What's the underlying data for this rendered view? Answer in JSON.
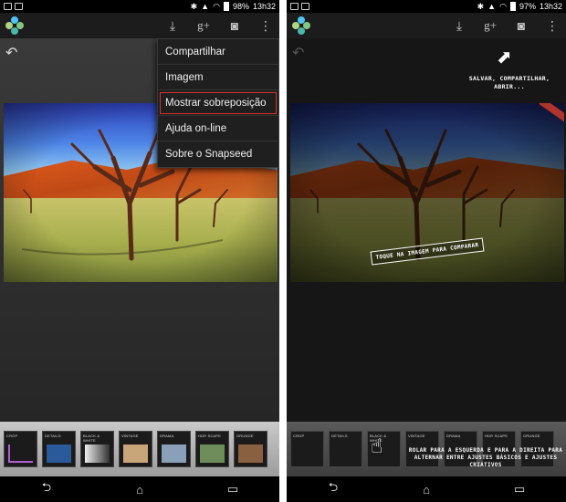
{
  "status_left": {
    "time": "13h32",
    "battery": "98%"
  },
  "status_right": {
    "time": "13h32",
    "battery": "97%"
  },
  "icons": {
    "download": "download-icon",
    "gplus": "g+",
    "camera": "camera-icon",
    "overflow": "overflow-icon",
    "back": "back-arrow-icon"
  },
  "menu": {
    "items": [
      {
        "label": "Compartilhar"
      },
      {
        "label": "Imagem"
      },
      {
        "label": "Mostrar sobreposição",
        "highlighted": true
      },
      {
        "label": "Ajuda on-line"
      },
      {
        "label": "Sobre o Snapseed"
      }
    ]
  },
  "overlay": {
    "save_hint": "Salvar, compartilhar, abrir...",
    "compare_hint": "Toque na imagem para comparar",
    "scroll_hint": "Rolar para a esquerda e para a direita para alternar entre ajustes básicos e ajustes criativos"
  },
  "filters": [
    {
      "label": "CROP"
    },
    {
      "label": "DETAILS"
    },
    {
      "label": "BLACK & WHITE"
    },
    {
      "label": "VINTAGE"
    },
    {
      "label": "DRAMA"
    },
    {
      "label": "HDR SCAPE"
    },
    {
      "label": "GRUNGE"
    }
  ],
  "colors": {
    "highlight": "#d6322b",
    "menu_bg": "#1f1f1f"
  }
}
